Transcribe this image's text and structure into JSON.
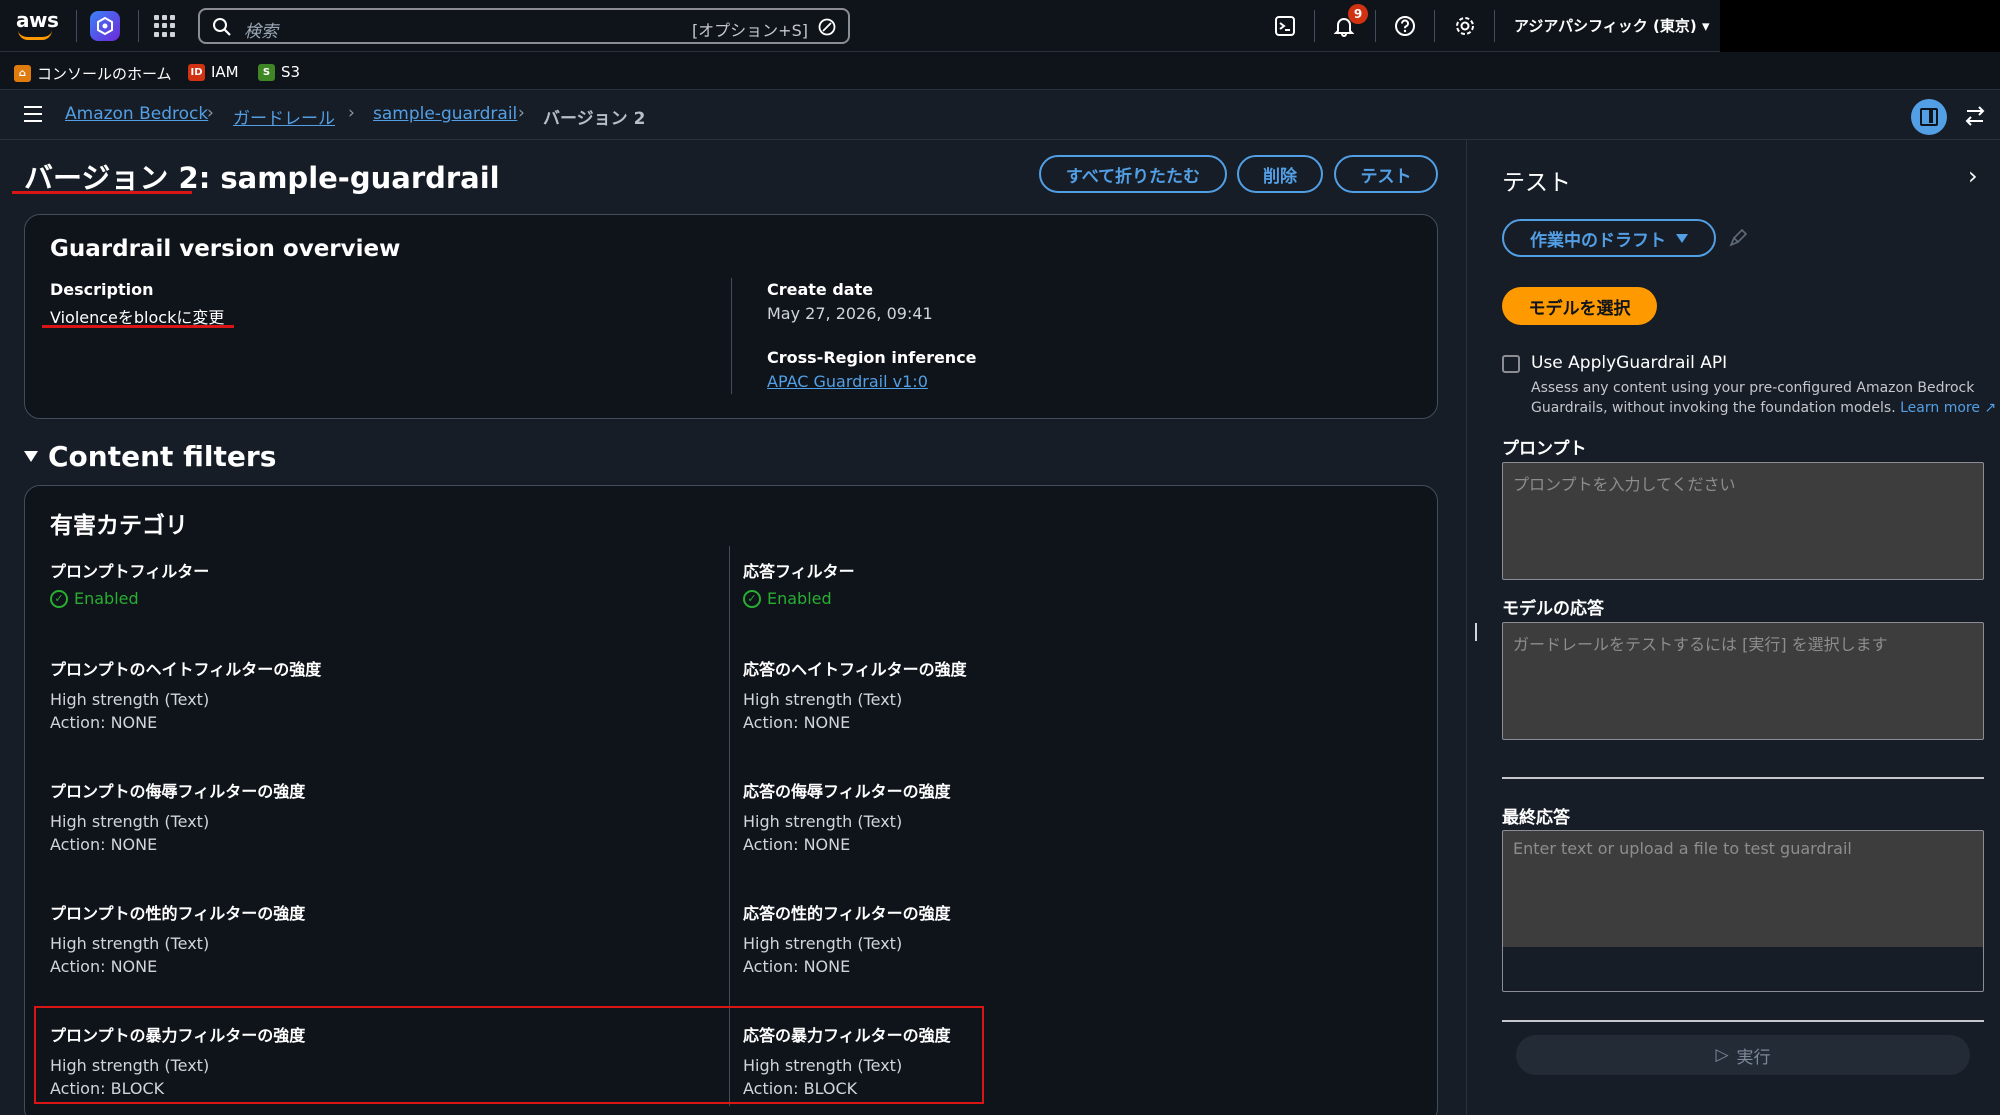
{
  "topnav": {
    "search_placeholder": "検索",
    "search_shortcut": "[オプション+S]",
    "notifications_count": "9",
    "region": "アジアパシフィック (東京)"
  },
  "favorites": [
    {
      "label": "コンソールのホーム",
      "color": "#e07b0d"
    },
    {
      "label": "IAM",
      "color": "#d13212"
    },
    {
      "label": "S3",
      "color": "#3f8624"
    }
  ],
  "breadcrumb": {
    "items": [
      "Amazon Bedrock",
      "ガードレール",
      "sample-guardrail"
    ],
    "current": "バージョン 2"
  },
  "header": {
    "title": "バージョン 2: sample-guardrail",
    "collapse_all": "すべて折りたたむ",
    "delete": "削除",
    "test": "テスト"
  },
  "overview": {
    "title": "Guardrail version overview",
    "description_label": "Description",
    "description_value": "Violenceをblockに変更",
    "create_date_label": "Create date",
    "create_date_value": "May 27, 2026, 09:41",
    "cross_region_label": "Cross-Region inference",
    "cross_region_value": "APAC Guardrail v1:0"
  },
  "content_filters": {
    "section_title": "Content filters",
    "container_title": "有害カテゴリ",
    "prompt_filter_label": "プロンプトフィルター",
    "prompt_filter_status": "Enabled",
    "response_filter_label": "応答フィルター",
    "response_filter_status": "Enabled",
    "prompt_items": [
      {
        "label": "プロンプトのヘイトフィルターの強度",
        "strength": "High strength (Text)",
        "action": "Action: NONE"
      },
      {
        "label": "プロンプトの侮辱フィルターの強度",
        "strength": "High strength (Text)",
        "action": "Action: NONE"
      },
      {
        "label": "プロンプトの性的フィルターの強度",
        "strength": "High strength (Text)",
        "action": "Action: NONE"
      },
      {
        "label": "プロンプトの暴力フィルターの強度",
        "strength": "High strength (Text)",
        "action": "Action: BLOCK"
      }
    ],
    "response_items": [
      {
        "label": "応答のヘイトフィルターの強度",
        "strength": "High strength (Text)",
        "action": "Action: NONE"
      },
      {
        "label": "応答の侮辱フィルターの強度",
        "strength": "High strength (Text)",
        "action": "Action: NONE"
      },
      {
        "label": "応答の性的フィルターの強度",
        "strength": "High strength (Text)",
        "action": "Action: NONE"
      },
      {
        "label": "応答の暴力フィルターの強度",
        "strength": "High strength (Text)",
        "action": "Action: BLOCK"
      }
    ]
  },
  "test_panel": {
    "title": "テスト",
    "draft_button": "作業中のドラフト",
    "select_model_button": "モデルを選択",
    "apply_api_label": "Use ApplyGuardrail API",
    "apply_api_desc_1": "Assess any content using your pre-configured Amazon Bedrock",
    "apply_api_desc_2": "Guardrails, without invoking the foundation models.",
    "learn_more": "Learn more",
    "prompt_label": "プロンプト",
    "prompt_placeholder": "プロンプトを入力してください",
    "model_response_label": "モデルの応答",
    "model_response_placeholder": "ガードレールをテストするには [実行] を選択します",
    "final_response_label": "最終応答",
    "final_response_placeholder": "Enter text or upload a file to test guardrail",
    "run_button": "実行"
  },
  "colors": {
    "accent": "#539fe5",
    "primary_button": "#ff9900",
    "success": "#29ad32",
    "highlight": "#d91515"
  }
}
